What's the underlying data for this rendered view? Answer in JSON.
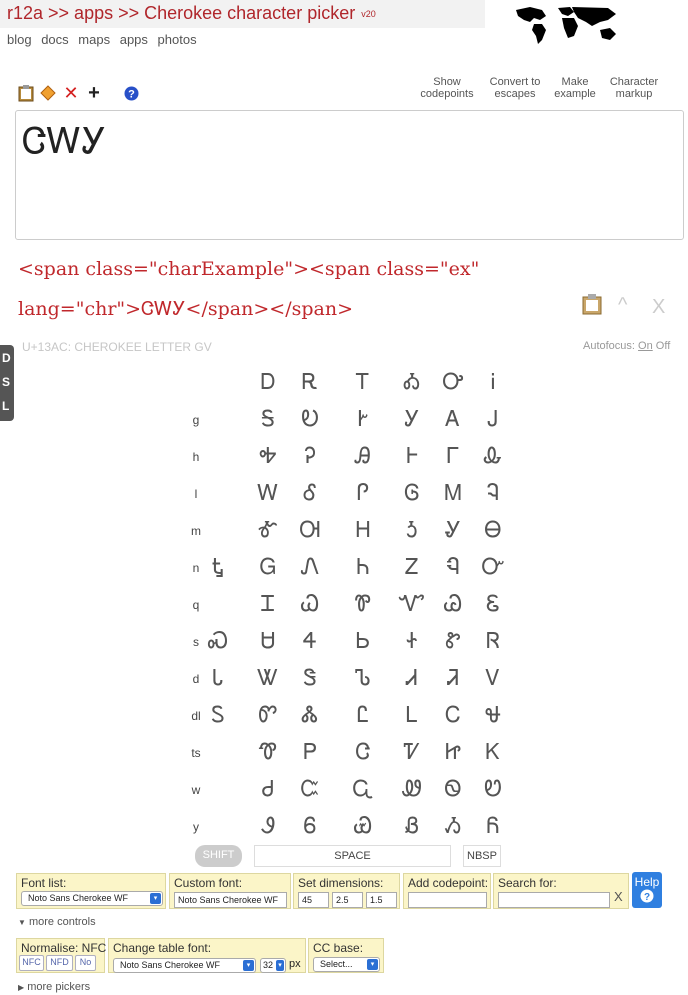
{
  "header": {
    "title": "r12a >> apps >> Cherokee character picker",
    "version": "v20",
    "nav": [
      "blog",
      "docs",
      "maps",
      "apps",
      "photos"
    ]
  },
  "toolbar": {
    "icons": [
      "clipboard-icon",
      "eraser-icon",
      "delete-icon",
      "add-icon",
      "help-icon"
    ],
    "show_codepoints": [
      "Show",
      "codepoints"
    ],
    "convert_escapes": [
      "Convert to",
      "escapes"
    ],
    "make_example": [
      "Make",
      "example"
    ],
    "char_markup": [
      "Character",
      "markup"
    ]
  },
  "editor": {
    "text": "ᏣᎳᎩ"
  },
  "markup_output": {
    "line1": "<span class=\"charExample\"><span class=\"ex\"",
    "line2": "lang=\"chr\">ᏣᎳᎩ</span></span>"
  },
  "char_info": "U+13AC: CHEROKEE LETTER GV",
  "autofocus": {
    "label": "Autofocus:",
    "on": "On",
    "off": "Off"
  },
  "side_tabs": [
    "D",
    "S",
    "L"
  ],
  "grid": {
    "rows": [
      {
        "label": "",
        "chars": [
          "",
          "Ꭰ",
          "Ꭱ",
          "Ꭲ",
          "Ꭳ",
          "Ꭴ",
          "Ꭵ"
        ]
      },
      {
        "label": "g",
        "chars": [
          "",
          "Ꭶ",
          "Ꭷ",
          "Ꭸ",
          "Ꭹ",
          "Ꭺ",
          "Ꭻ"
        ]
      },
      {
        "label": "h",
        "chars": [
          "",
          "Ꭽ",
          "Ꭾ",
          "Ꭿ",
          "Ꮀ",
          "Ꮁ",
          "Ꮂ"
        ]
      },
      {
        "label": "l",
        "chars": [
          "",
          "Ꮃ",
          "Ꮄ",
          "Ꮅ",
          "Ꮆ",
          "Ꮇ",
          "Ꮈ"
        ]
      },
      {
        "label": "m",
        "chars": [
          "",
          "Ꮉ",
          "Ꮊ",
          "Ꮋ",
          "Ꮌ",
          "Ꮍ",
          "Ꮎ"
        ]
      },
      {
        "label": "n",
        "chars": [
          "Ꮏ",
          "Ꮐ",
          "Ꮑ",
          "Ꮒ",
          "Ꮓ",
          "Ꮔ",
          "Ꮕ"
        ]
      },
      {
        "label": "q",
        "chars": [
          "",
          "Ꮖ",
          "Ꮗ",
          "Ꮘ",
          "Ꮙ",
          "Ꮚ",
          "Ꮛ"
        ]
      },
      {
        "label": "s",
        "chars": [
          "Ꮝ",
          "Ꮜ",
          "Ꮞ",
          "Ꮟ",
          "Ꮠ",
          "Ꮡ",
          "Ꮢ"
        ]
      },
      {
        "label": "d",
        "chars": [
          "Ꮣ",
          "Ꮤ",
          "Ꮥ",
          "Ꮦ",
          "Ꮧ",
          "Ꮨ",
          "Ꮩ"
        ]
      },
      {
        "label": "dl",
        "chars": [
          "Ꮪ",
          "Ꮫ",
          "Ꮬ",
          "Ꮭ",
          "Ꮮ",
          "Ꮯ",
          "Ꮰ"
        ]
      },
      {
        "label": "ts",
        "chars": [
          "",
          "Ꮱ",
          "Ꮲ",
          "Ꮳ",
          "Ꮴ",
          "Ꮵ",
          "Ꮶ"
        ]
      },
      {
        "label": "w",
        "chars": [
          "",
          "Ꮷ",
          "Ꮸ",
          "Ꮹ",
          "Ꮺ",
          "Ꮻ",
          "Ꮼ"
        ]
      },
      {
        "label": "y",
        "chars": [
          "",
          "Ꮽ",
          "Ꮾ",
          "Ꮿ",
          "Ᏸ",
          "Ᏹ",
          "Ᏺ"
        ]
      }
    ]
  },
  "bottom_buttons": {
    "shift": "SHIFT",
    "space": "SPACE",
    "nbsp": "NBSP"
  },
  "controls": {
    "font_list_label": "Font list:",
    "font_list_value": "Noto Sans Cherokee WF",
    "custom_font_label": "Custom font:",
    "custom_font_value": "Noto Sans Cherokee WF",
    "dimensions_label": "Set dimensions:",
    "dim_values": [
      "45",
      "2.5",
      "1.5"
    ],
    "add_codepoint_label": "Add codepoint:",
    "search_label": "Search for:",
    "search_clear": "X",
    "help_label": "Help",
    "more_controls": "more controls",
    "normalise_label": "Normalise: NFC",
    "nfc": "NFC",
    "nfd": "NFD",
    "no": "No",
    "table_font_label": "Change table font:",
    "table_font_value": "Noto Sans Cherokee WF",
    "table_font_size": "32",
    "table_font_unit": "px",
    "cc_base_label": "CC base:",
    "cc_base_value": "Select...",
    "more_pickers": "more pickers"
  },
  "colors": {
    "accent": "#b0262b",
    "panel": "#fbf5c8",
    "help_blue": "#2f7fe0"
  }
}
